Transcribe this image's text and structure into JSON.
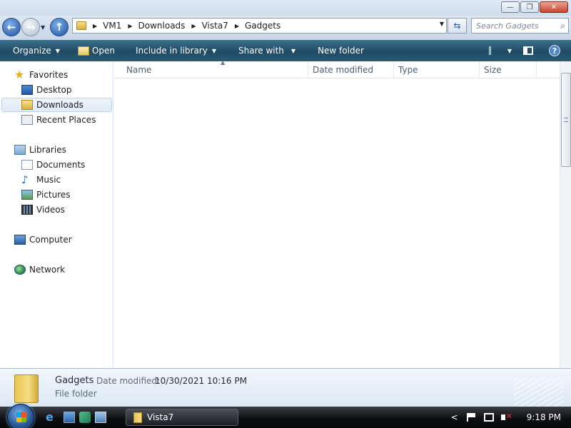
{
  "window": {
    "minimize_symbol": "—",
    "maximize_symbol": "❐",
    "close_symbol": "✕"
  },
  "address": {
    "crumbs": [
      "VM1",
      "Downloads",
      "Vista7",
      "Gadgets"
    ]
  },
  "search": {
    "placeholder": "Search Gadgets"
  },
  "toolbar": {
    "organize": "Organize",
    "open": "Open",
    "include_in_library": "Include in library",
    "share_with": "Share with",
    "new_folder": "New folder"
  },
  "nav": {
    "favorites": "Favorites",
    "desktop": "Desktop",
    "downloads": "Downloads",
    "recent_places": "Recent Places",
    "libraries": "Libraries",
    "documents": "Documents",
    "music": "Music",
    "pictures": "Pictures",
    "videos": "Videos",
    "computer": "Computer",
    "network": "Network"
  },
  "columns": {
    "name": "Name",
    "date_modified": "Date modified",
    "type": "Type",
    "size": "Size"
  },
  "details": {
    "name": "Gadgets",
    "date_label": "Date modified:",
    "date_value": "10/30/2021 10:16 PM",
    "kind": "File folder"
  },
  "taskbar": {
    "window_button": "Vista7",
    "clock": "9:18 PM",
    "tray_chevron": "<"
  },
  "icons": {
    "favorites": "star-icon",
    "desktop": "desktop-icon",
    "downloads": "folder-icon",
    "recent_places": "recent-places-icon",
    "libraries": "libraries-icon",
    "documents": "document-icon",
    "music": "music-note-icon",
    "pictures": "pictures-icon",
    "videos": "videos-icon",
    "computer": "computer-icon",
    "network": "network-icon"
  },
  "colors": {
    "command_bar": "#1e4a64",
    "selection": "#dfeaf7",
    "close_button": "#c8452d"
  }
}
